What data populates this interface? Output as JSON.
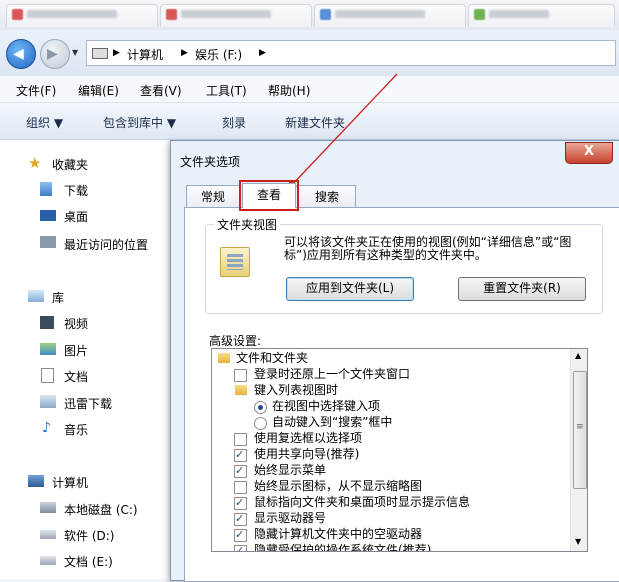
{
  "explorer": {
    "address": {
      "computer": "计算机",
      "drive": "娱乐 (F:)"
    },
    "menus": [
      "文件(F)",
      "编辑(E)",
      "查看(V)",
      "工具(T)",
      "帮助(H)"
    ],
    "toolbar": {
      "organize": "组织 ▼",
      "include": "包含到库中 ▼",
      "burn": "刻录",
      "new_folder": "新建文件夹"
    },
    "nav": {
      "favorites": "收藏夹",
      "downloads": "下载",
      "desktop": "桌面",
      "recent": "最近访问的位置",
      "libraries": "库",
      "videos": "视频",
      "pictures": "图片",
      "documents": "文档",
      "xunlei": "迅雷下载",
      "music": "音乐",
      "computer": "计算机",
      "local_c": "本地磁盘 (C:)",
      "software_d": "软件 (D:)",
      "docs_e": "文档 (E:)"
    }
  },
  "dialog": {
    "title": "文件夹选项",
    "close": "X",
    "tabs": [
      "常规",
      "查看",
      "搜索"
    ],
    "active_tab": "查看",
    "folder_view": {
      "legend": "文件夹视图",
      "description": "可以将该文件夹正在使用的视图(例如“详细信息”或“图标”)应用到所有这种类型的文件夹中。",
      "apply_button": "应用到文件夹(L)",
      "reset_button": "重置文件夹(R)"
    },
    "advanced_label": "高级设置:",
    "advanced_items": [
      {
        "type": "folder",
        "text": "文件和文件夹"
      },
      {
        "type": "check",
        "checked": false,
        "text": "登录时还原上一个文件夹窗口"
      },
      {
        "type": "folder",
        "text": "键入列表视图时"
      },
      {
        "type": "radio",
        "checked": true,
        "text": "在视图中选择键入项"
      },
      {
        "type": "radio",
        "checked": false,
        "text": "自动键入到“搜索”框中"
      },
      {
        "type": "check",
        "checked": false,
        "text": "使用复选框以选择项"
      },
      {
        "type": "check",
        "checked": true,
        "text": "使用共享向导(推荐)"
      },
      {
        "type": "check",
        "checked": true,
        "text": "始终显示菜单"
      },
      {
        "type": "check",
        "checked": false,
        "text": "始终显示图标，从不显示缩略图"
      },
      {
        "type": "check",
        "checked": true,
        "text": "鼠标指向文件夹和桌面项时显示提示信息"
      },
      {
        "type": "check",
        "checked": true,
        "text": "显示驱动器号"
      },
      {
        "type": "check",
        "checked": true,
        "text": "隐藏计算机文件夹中的空驱动器"
      },
      {
        "type": "check",
        "checked": true,
        "text": "隐藏受保护的操作系统文件(推荐)"
      }
    ]
  },
  "colors": {
    "annotation": "#cc1f1f",
    "accent": "#1e4f94"
  }
}
